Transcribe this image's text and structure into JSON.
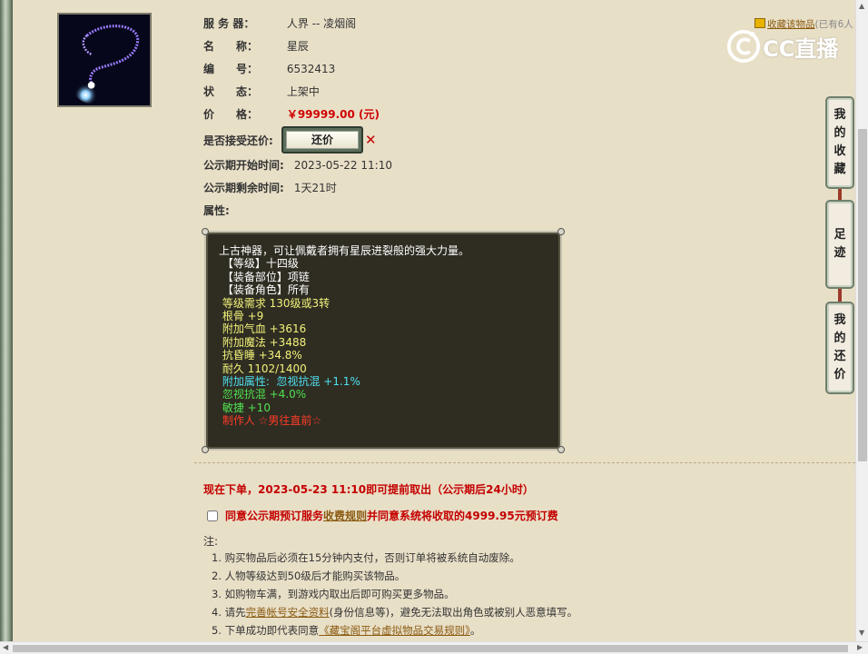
{
  "item": {
    "server_label": "服 务 器：",
    "server_value": "人界 -- 凌烟阁",
    "name_label": "名　　称：",
    "name_value": "星辰",
    "id_label": "编　　号：",
    "id_value": "6532413",
    "status_label": "状　　态：",
    "status_value": "上架中",
    "price_label": "价　　格：",
    "price_value": "￥99999.00 (元)",
    "counter_label": "是否接受还价:",
    "counter_button": "还价",
    "counter_mark": "✕",
    "start_label": "公示期开始时间:",
    "start_value": "2023-05-22 11:10",
    "remain_label": "公示期剩余时间:",
    "remain_value": "1天21时",
    "attr_label": "属性:"
  },
  "attributes": [
    {
      "text": "上古神器，可让佩戴者拥有星辰进裂般的强大力量。",
      "color": "white"
    },
    {
      "text": " 【等级】十四级",
      "color": "white"
    },
    {
      "text": " 【装备部位】项链",
      "color": "white"
    },
    {
      "text": " 【装备角色】所有",
      "color": "white"
    },
    {
      "text": " 等级需求 130级或3转",
      "color": "yellow"
    },
    {
      "text": " 根骨 +9",
      "color": "yellow"
    },
    {
      "text": " 附加气血 +3616",
      "color": "yellow"
    },
    {
      "text": " 附加魔法 +3488",
      "color": "yellow"
    },
    {
      "text": " 抗昏睡 +34.8%",
      "color": "yellow"
    },
    {
      "text": " 耐久 1102/1400",
      "color": "yellow"
    },
    {
      "text": " 附加属性:  忽视抗混 +1.1%",
      "color": "cyan"
    },
    {
      "text": " 忽视抗混 +4.0%",
      "color": "green"
    },
    {
      "text": " 敏捷 +10",
      "color": "green"
    },
    {
      "text": " 制作人 ☆男往直前☆",
      "color": "red"
    }
  ],
  "order": {
    "notice": "现在下单，2023-05-23 11:10即可提前取出（公示期后24小时）",
    "agree_prefix": "同意公示期预订服务",
    "agree_link": "收费规则",
    "agree_suffix": " 并同意系统将收取的4999.95元预订费",
    "notes_title": "注:",
    "notes": [
      {
        "prefix": "1. 购买物品后必须在15分钟内支付，否则订单将被系统自动废除。",
        "link": "",
        "suffix": ""
      },
      {
        "prefix": "2. 人物等级达到50级后才能购买该物品。",
        "link": "",
        "suffix": ""
      },
      {
        "prefix": "3. 如购物车满，到游戏内取出后即可购买更多物品。",
        "link": "",
        "suffix": ""
      },
      {
        "prefix": "4. 请先",
        "link": "完善帐号安全资料",
        "suffix": "(身份信息等)，避免无法取出角色或被别人恶意填写。"
      },
      {
        "prefix": "5. 下单成功即代表同意",
        "link": "《藏宝阁平台虚拟物品交易规则》",
        "suffix": "。"
      }
    ]
  },
  "favorite": {
    "link": "收藏该物品",
    "count": "(已有6人"
  },
  "watermark": "CC直播",
  "side_tabs": {
    "favorites": [
      "我",
      "的",
      "收",
      "藏"
    ],
    "footprints": [
      "足",
      "迹"
    ],
    "counteroffers": [
      "我",
      "的",
      "还",
      "价"
    ]
  },
  "colors": {
    "price": "#d00000",
    "attr_bg": "#2f2d22",
    "page_bg": "#e8dfc7"
  }
}
